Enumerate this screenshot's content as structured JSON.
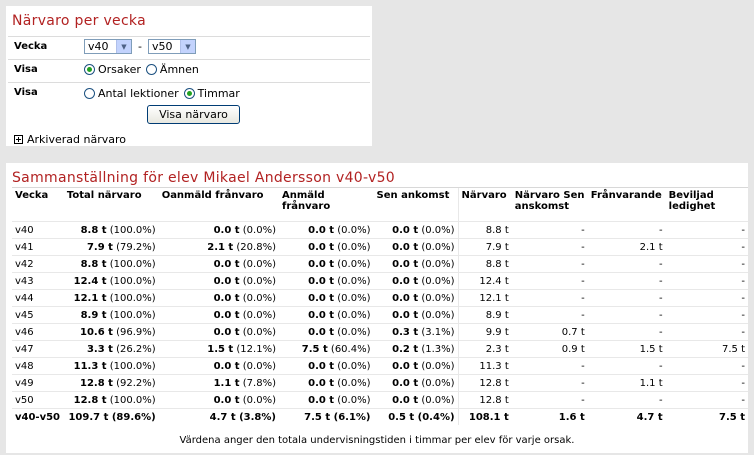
{
  "filter": {
    "title": "Närvaro per vecka",
    "week_label": "Vecka",
    "week_from": "v40",
    "week_sep": "-",
    "week_to": "v50",
    "show_label1": "Visa",
    "opt_reasons": "Orsaker",
    "opt_subjects": "Ämnen",
    "show_label2": "Visa",
    "opt_lessons": "Antal lektioner",
    "opt_hours": "Timmar",
    "button": "Visa närvaro",
    "archived": "Arkiverad närvaro"
  },
  "summary": {
    "title": "Sammanställning för elev Mikael Andersson v40-v50",
    "columns": [
      "Vecka",
      "Total närvaro",
      "Oanmäld frånvaro",
      "Anmäld frånvaro",
      "Sen ankomst",
      "Närvaro",
      "Närvaro Sen anskomst",
      "Frånvarande",
      "Beviljad ledighet"
    ],
    "rows": [
      {
        "week": "v40",
        "total": [
          "8.8 t",
          "(100.0%)"
        ],
        "oanmald": [
          "0.0 t",
          "(0.0%)"
        ],
        "anmald": [
          "0.0 t",
          "(0.0%)"
        ],
        "sen": [
          "0.0 t",
          "(0.0%)"
        ],
        "narvaro": "8.8 t",
        "narvaro_sen": "-",
        "franv": "-",
        "bevil": "-"
      },
      {
        "week": "v41",
        "total": [
          "7.9 t",
          "(79.2%)"
        ],
        "oanmald": [
          "2.1 t",
          "(20.8%)"
        ],
        "anmald": [
          "0.0 t",
          "(0.0%)"
        ],
        "sen": [
          "0.0 t",
          "(0.0%)"
        ],
        "narvaro": "7.9 t",
        "narvaro_sen": "-",
        "franv": "2.1 t",
        "bevil": "-"
      },
      {
        "week": "v42",
        "total": [
          "8.8 t",
          "(100.0%)"
        ],
        "oanmald": [
          "0.0 t",
          "(0.0%)"
        ],
        "anmald": [
          "0.0 t",
          "(0.0%)"
        ],
        "sen": [
          "0.0 t",
          "(0.0%)"
        ],
        "narvaro": "8.8 t",
        "narvaro_sen": "-",
        "franv": "-",
        "bevil": "-"
      },
      {
        "week": "v43",
        "total": [
          "12.4 t",
          "(100.0%)"
        ],
        "oanmald": [
          "0.0 t",
          "(0.0%)"
        ],
        "anmald": [
          "0.0 t",
          "(0.0%)"
        ],
        "sen": [
          "0.0 t",
          "(0.0%)"
        ],
        "narvaro": "12.4 t",
        "narvaro_sen": "-",
        "franv": "-",
        "bevil": "-"
      },
      {
        "week": "v44",
        "total": [
          "12.1 t",
          "(100.0%)"
        ],
        "oanmald": [
          "0.0 t",
          "(0.0%)"
        ],
        "anmald": [
          "0.0 t",
          "(0.0%)"
        ],
        "sen": [
          "0.0 t",
          "(0.0%)"
        ],
        "narvaro": "12.1 t",
        "narvaro_sen": "-",
        "franv": "-",
        "bevil": "-"
      },
      {
        "week": "v45",
        "total": [
          "8.9 t",
          "(100.0%)"
        ],
        "oanmald": [
          "0.0 t",
          "(0.0%)"
        ],
        "anmald": [
          "0.0 t",
          "(0.0%)"
        ],
        "sen": [
          "0.0 t",
          "(0.0%)"
        ],
        "narvaro": "8.9 t",
        "narvaro_sen": "-",
        "franv": "-",
        "bevil": "-"
      },
      {
        "week": "v46",
        "total": [
          "10.6 t",
          "(96.9%)"
        ],
        "oanmald": [
          "0.0 t",
          "(0.0%)"
        ],
        "anmald": [
          "0.0 t",
          "(0.0%)"
        ],
        "sen": [
          "0.3 t",
          "(3.1%)"
        ],
        "narvaro": "9.9 t",
        "narvaro_sen": "0.7 t",
        "franv": "-",
        "bevil": "-"
      },
      {
        "week": "v47",
        "total": [
          "3.3 t",
          "(26.2%)"
        ],
        "oanmald": [
          "1.5 t",
          "(12.1%)"
        ],
        "anmald": [
          "7.5 t",
          "(60.4%)"
        ],
        "sen": [
          "0.2 t",
          "(1.3%)"
        ],
        "narvaro": "2.3 t",
        "narvaro_sen": "0.9 t",
        "franv": "1.5 t",
        "bevil": "7.5 t"
      },
      {
        "week": "v48",
        "total": [
          "11.3 t",
          "(100.0%)"
        ],
        "oanmald": [
          "0.0 t",
          "(0.0%)"
        ],
        "anmald": [
          "0.0 t",
          "(0.0%)"
        ],
        "sen": [
          "0.0 t",
          "(0.0%)"
        ],
        "narvaro": "11.3 t",
        "narvaro_sen": "-",
        "franv": "-",
        "bevil": "-"
      },
      {
        "week": "v49",
        "total": [
          "12.8 t",
          "(92.2%)"
        ],
        "oanmald": [
          "1.1 t",
          "(7.8%)"
        ],
        "anmald": [
          "0.0 t",
          "(0.0%)"
        ],
        "sen": [
          "0.0 t",
          "(0.0%)"
        ],
        "narvaro": "12.8 t",
        "narvaro_sen": "-",
        "franv": "1.1 t",
        "bevil": "-"
      },
      {
        "week": "v50",
        "total": [
          "12.8 t",
          "(100.0%)"
        ],
        "oanmald": [
          "0.0 t",
          "(0.0%)"
        ],
        "anmald": [
          "0.0 t",
          "(0.0%)"
        ],
        "sen": [
          "0.0 t",
          "(0.0%)"
        ],
        "narvaro": "12.8 t",
        "narvaro_sen": "-",
        "franv": "-",
        "bevil": "-"
      }
    ],
    "total": {
      "week": "v40-v50",
      "total": [
        "109.7 t",
        "(89.6%)"
      ],
      "oanmald": [
        "4.7 t",
        "(3.8%)"
      ],
      "anmald": [
        "7.5 t",
        "(6.1%)"
      ],
      "sen": [
        "0.5 t",
        "(0.4%)"
      ],
      "narvaro": "108.1 t",
      "narvaro_sen": "1.6 t",
      "franv": "4.7 t",
      "bevil": "7.5 t"
    },
    "footnote": "Värdena anger den totala undervisningstiden i timmar per elev för varje orsak."
  }
}
